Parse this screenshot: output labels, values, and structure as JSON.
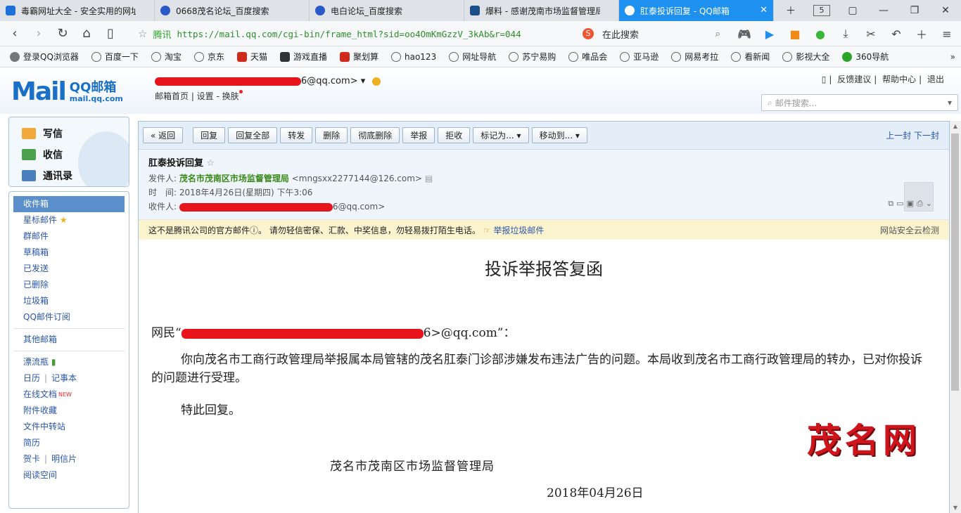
{
  "tabs": [
    {
      "label": "毒霸网址大全 - 安全实用的网址导",
      "icon_color": "#1e6fd9"
    },
    {
      "label": "0668茂名论坛_百度搜索",
      "icon_color": "#2a5ac8"
    },
    {
      "label": "电白论坛_百度搜索",
      "icon_color": "#2a5ac8"
    },
    {
      "label": "爆料 - 感谢茂南市场监督管理局5",
      "icon_color": "#1a4f8a"
    },
    {
      "label": "肛泰投诉回复 - QQ邮箱",
      "icon_color": "#ffffff",
      "active": true
    }
  ],
  "tab_count": "5",
  "address": {
    "site": "腾讯",
    "url": "https://mail.qq.com/cgi-bin/frame_html?sid=oo4OmKmGzzV_3kAb&r=044"
  },
  "search_placeholder": "在此搜索",
  "bookmarks": [
    "登录QQ浏览器",
    "百度一下",
    "淘宝",
    "京东",
    "天猫",
    "游戏直播",
    "聚划算",
    "hao123",
    "网址导航",
    "苏宁易购",
    "唯品会",
    "亚马逊",
    "网易考拉",
    "看新闻",
    "影视大全",
    "360导航"
  ],
  "mail_header": {
    "logo_word": "Mail",
    "logo_cn": "QQ邮箱",
    "logo_domain": "mail.qq.com",
    "user_suffix": "6@qq.com>",
    "links": "邮箱首页 | 设置 - 换肤",
    "top_links": [
      "反馈建议",
      "帮助中心",
      "退出"
    ],
    "search_placeholder": "邮件搜索..."
  },
  "sidebar": {
    "actions": [
      "写信",
      "收信",
      "通讯录"
    ],
    "folders": [
      "收件箱",
      "星标邮件",
      "群邮件",
      "草稿箱",
      "已发送",
      "已删除",
      "垃圾箱",
      "QQ邮件订阅"
    ],
    "other": "其他邮箱",
    "apps": [
      "漂流瓶",
      "日历",
      "记事本",
      "在线文档",
      "附件收藏",
      "文件中转站",
      "简历",
      "贺卡",
      "明信片",
      "阅读空间"
    ],
    "new_badge": "NEW"
  },
  "toolbar": {
    "buttons": [
      "« 返回",
      "回复",
      "回复全部",
      "转发",
      "删除",
      "彻底删除",
      "举报",
      "拒收",
      "标记为... ▾",
      "移动到... ▾"
    ],
    "prev": "上一封",
    "next": "下一封"
  },
  "mail": {
    "subject": "肛泰投诉回复",
    "from_label": "发件人:",
    "from_name": "茂名市茂南区市场监督管理局",
    "from_addr": "<mngsxx2277144@126.com>",
    "time_label": "时　间:",
    "time": "2018年4月26日(星期四) 下午3:06",
    "to_label": "收件人:",
    "to_suffix": "6@qq.com>"
  },
  "warning": {
    "text": "这不是腾讯公司的官方邮件ⓘ。 请勿轻信密保、汇款、中奖信息，勿轻易拨打陌生电话。",
    "report": "举报垃圾邮件",
    "security": "网站安全云检测"
  },
  "body": {
    "title": "投诉举报答复函",
    "greeting_prefix": "网民“",
    "greeting_suffix": "6>@qq.com”：",
    "para": "你向茂名市工商行政管理局举报属本局管辖的茂名肛泰门诊部涉嫌发布违法广告的问题。本局收到茂名市工商行政管理局的转办，已对你投诉的问题进行受理。",
    "closing": "特此回复。",
    "signature": "茂名市茂南区市场监督管理局",
    "date": "2018年04月26日",
    "watermark": "茂名网"
  }
}
